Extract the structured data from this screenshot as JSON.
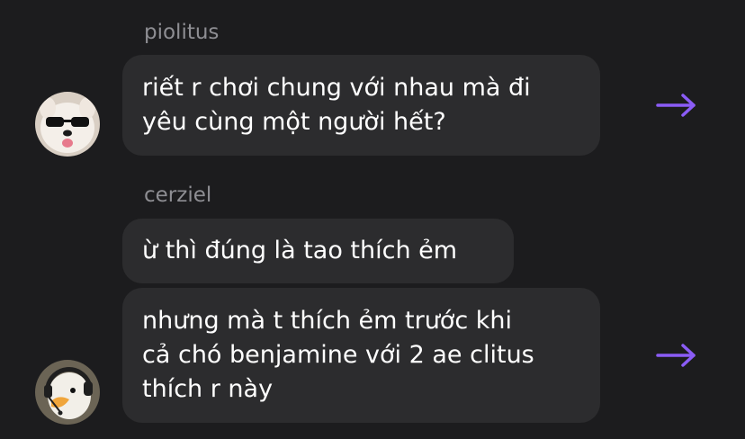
{
  "messages": [
    {
      "sender": "piolitus",
      "bubbles": [
        {
          "lines": [
            "riết r chơi chung với nhau mà đi",
            "yêu cùng một người hết?"
          ]
        }
      ],
      "avatar_icon": "dog-with-sunglasses-avatar",
      "action_icon": "forward-arrow-icon"
    },
    {
      "sender": "cerziel",
      "bubbles": [
        {
          "lines": [
            "ừ thì đúng là tao thích ẻm"
          ]
        },
        {
          "lines": [
            "nhưng mà t thích ẻm trước khi",
            "cả chó benjamine với 2 ae clitus",
            "thích r này"
          ]
        }
      ],
      "avatar_icon": "duck-with-headset-avatar",
      "action_icon": "forward-arrow-icon"
    }
  ],
  "colors": {
    "background": "#1c1c1e",
    "bubble": "#2c2c2e",
    "text": "#ffffff",
    "sender": "#8e8e93",
    "accent": "#8b5cf6"
  }
}
